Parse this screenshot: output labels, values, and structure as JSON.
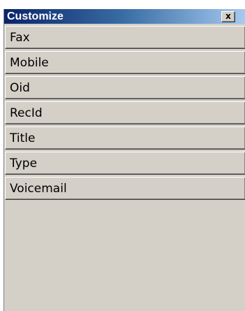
{
  "window": {
    "title": "Customize",
    "close_label": "x"
  },
  "fields": [
    {
      "label": "Fax"
    },
    {
      "label": "Mobile"
    },
    {
      "label": "Oid"
    },
    {
      "label": "RecId"
    },
    {
      "label": "Title"
    },
    {
      "label": "Type"
    },
    {
      "label": "Voicemail"
    }
  ],
  "colors": {
    "title_bar_start": "#0a246a",
    "title_bar_end": "#a6caf0",
    "face": "#d4d0c8"
  }
}
